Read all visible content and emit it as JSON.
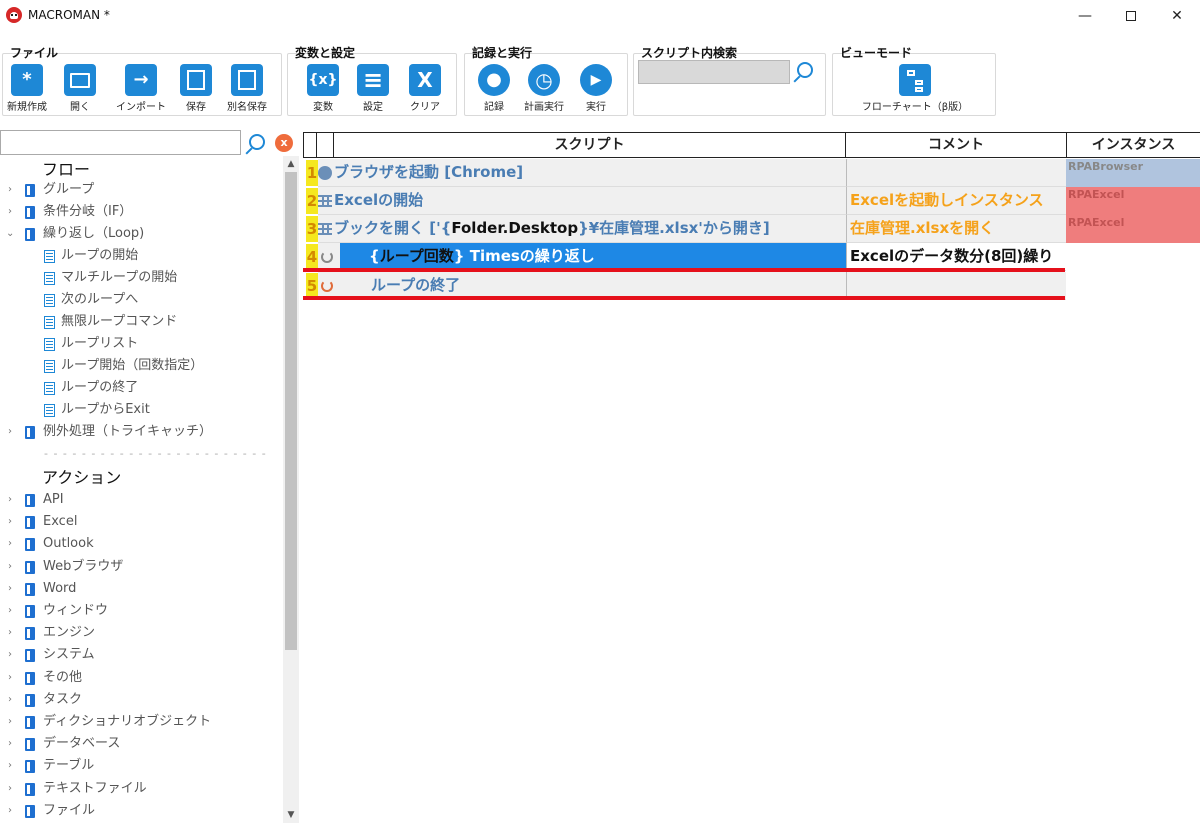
{
  "window": {
    "title": "MACROMAN *",
    "minimize": "—",
    "close": "✕"
  },
  "ribbon": {
    "file": {
      "title": "ファイル",
      "buttons": [
        {
          "label": "新規作成",
          "icon": "asterisk-icon",
          "glyph": "*"
        },
        {
          "label": "開く",
          "icon": "folder-icon",
          "glyph": ""
        },
        {
          "label": "インポート",
          "icon": "arrow-right-icon",
          "glyph": "→"
        },
        {
          "label": "保存",
          "icon": "save-icon",
          "glyph": ""
        },
        {
          "label": "別名保存",
          "icon": "save-as-icon",
          "glyph": ""
        }
      ]
    },
    "vars": {
      "title": "変数と設定",
      "buttons": [
        {
          "label": "変数",
          "icon": "variable-icon",
          "glyph": "{x}"
        },
        {
          "label": "設定",
          "icon": "settings-list-icon",
          "glyph": "≡"
        },
        {
          "label": "クリア",
          "icon": "clear-icon",
          "glyph": "X"
        }
      ]
    },
    "run": {
      "title": "記録と実行",
      "buttons": [
        {
          "label": "記録",
          "icon": "record-icon",
          "glyph": "●"
        },
        {
          "label": "計画実行",
          "icon": "schedule-icon",
          "glyph": "◷"
        },
        {
          "label": "実行",
          "icon": "play-icon",
          "glyph": "▶"
        }
      ]
    },
    "search": {
      "title": "スクリプト内検索",
      "value": ""
    },
    "view": {
      "title": "ビューモード",
      "button": {
        "label": "フローチャート（β版）",
        "icon": "flowchart-icon"
      }
    }
  },
  "tree": {
    "search_value": "",
    "clear_glyph": "x",
    "flow_heading": "フロー",
    "flow_items": [
      {
        "label": "グループ",
        "level": 0,
        "expanded": false
      },
      {
        "label": "条件分岐（IF）",
        "level": 0,
        "expanded": false
      },
      {
        "label": "繰り返し（Loop)",
        "level": 0,
        "expanded": true
      },
      {
        "label": "ループの開始",
        "level": 1
      },
      {
        "label": "マルチループの開始",
        "level": 1
      },
      {
        "label": "次のループへ",
        "level": 1
      },
      {
        "label": "無限ループコマンド",
        "level": 1
      },
      {
        "label": "ループリスト",
        "level": 1
      },
      {
        "label": "ループ開始（回数指定）",
        "level": 1
      },
      {
        "label": "ループの終了",
        "level": 1
      },
      {
        "label": "ループからExit",
        "level": 1
      },
      {
        "label": "例外処理（トライキャッチ）",
        "level": 0,
        "expanded": false
      }
    ],
    "separator": "- - - - - - - - - - - - - - - - - - - - - - - -",
    "action_heading": "アクション",
    "action_items": [
      "API",
      "Excel",
      "Outlook",
      "Webブラウザ",
      "Word",
      "ウィンドウ",
      "エンジン",
      "システム",
      "その他",
      "タスク",
      "ディクショナリオブジェクト",
      "データベース",
      "テーブル",
      "テキストファイル",
      "ファイル"
    ]
  },
  "grid": {
    "headers": {
      "script": "スクリプト",
      "comment": "コメント",
      "instance": "インスタンス"
    },
    "rows": [
      {
        "num": "1",
        "icon": "chrome-icon",
        "script": "ブラウザを起動 [Chrome]",
        "comment": "",
        "instance": "RPABrowser"
      },
      {
        "num": "2",
        "icon": "excel-grid-icon",
        "script": "Excelの開始",
        "comment": "Excelを起動しインスタンス",
        "instance": "RPAExcel"
      },
      {
        "num": "3",
        "icon": "excel-grid-icon",
        "script_pre": "ブックを開く ['{",
        "script_var": "Folder.Desktop",
        "script_post": "}¥在庫管理.xlsx'から開き]",
        "comment": "在庫管理.xlsxを開く",
        "instance": "RPAExcel"
      },
      {
        "num": "4",
        "icon": "loop-icon",
        "script_brace_open": "{",
        "script_var": "ループ回数",
        "script_brace_close": "}",
        "script_post": " Timesの繰り返し",
        "comment": "Excelのデータ数分(8回)繰り",
        "instance": "",
        "selected": true
      },
      {
        "num": "5",
        "icon": "loop-end-icon",
        "script": "ループの終了",
        "comment": "",
        "instance": ""
      }
    ]
  }
}
